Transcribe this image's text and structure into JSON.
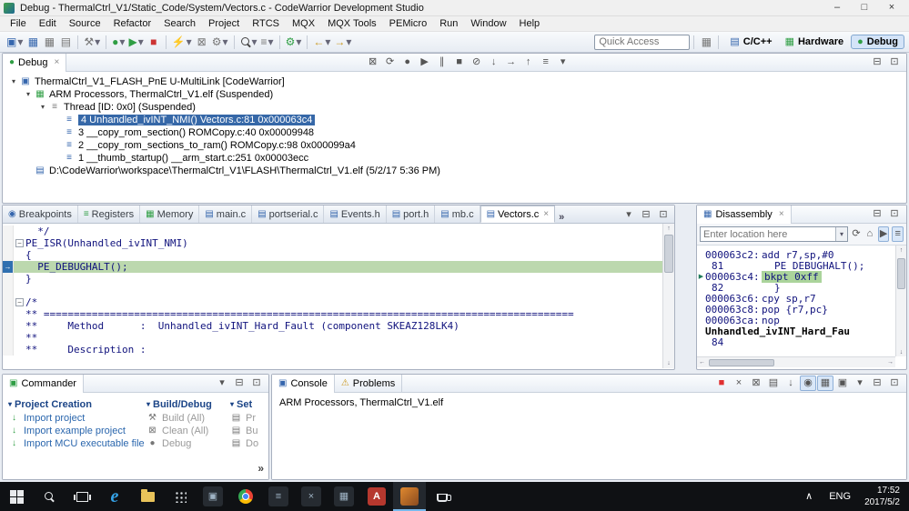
{
  "window": {
    "title": "Debug - ThermalCtrl_V1/Static_Code/System/Vectors.c - CodeWarrior Development Studio"
  },
  "menubar": {
    "items": [
      "File",
      "Edit",
      "Source",
      "Refactor",
      "Search",
      "Project",
      "RTCS",
      "MQX",
      "MQX Tools",
      "PEMicro",
      "Run",
      "Window",
      "Help"
    ]
  },
  "toolbar": {
    "quick_access_placeholder": "Quick Access",
    "perspectives": {
      "cpp": "C/C++",
      "hardware": "Hardware",
      "debug": "Debug"
    }
  },
  "debug_view": {
    "tab": "Debug",
    "tree": [
      {
        "label": "ThermalCtrl_V1_FLASH_PnE U-MultiLink [CodeWarrior]"
      },
      {
        "label": "ARM Processors, ThermalCtrl_V1.elf (Suspended)"
      },
      {
        "label": "Thread [ID: 0x0] (Suspended)"
      },
      {
        "label": "4 Unhandled_ivINT_NMI() Vectors.c:81 0x000063c4"
      },
      {
        "label": "3 __copy_rom_section() ROMCopy.c:40 0x00009948"
      },
      {
        "label": "2 __copy_rom_sections_to_ram() ROMCopy.c:98 0x000099a4"
      },
      {
        "label": "1 __thumb_startup() __arm_start.c:251 0x00003ecc"
      },
      {
        "label": "D:\\CodeWarrior\\workspace\\ThermalCtrl_V1\\FLASH\\ThermalCtrl_V1.elf (5/2/17 5:36 PM)"
      }
    ]
  },
  "editor": {
    "tabs": [
      {
        "label": "Breakpoints"
      },
      {
        "label": "Registers"
      },
      {
        "label": "Memory"
      },
      {
        "label": "main.c"
      },
      {
        "label": "portserial.c"
      },
      {
        "label": "Events.h"
      },
      {
        "label": "port.h"
      },
      {
        "label": "mb.c"
      },
      {
        "label": "Vectors.c"
      }
    ],
    "overflow": "»",
    "lines": [
      {
        "text": "  */"
      },
      {
        "text": "PE_ISR(Unhandled_ivINT_NMI)"
      },
      {
        "text": "{"
      },
      {
        "text": "  PE_DEBUGHALT();"
      },
      {
        "text": "}"
      },
      {
        "text": ""
      },
      {
        "text": "/*"
      },
      {
        "text": "** ========================================================================================"
      },
      {
        "text": "**     Method      :  Unhandled_ivINT_Hard_Fault (component SKEAZ128LK4)"
      },
      {
        "text": "**"
      },
      {
        "text": "**     Description :"
      }
    ]
  },
  "disassembly": {
    "title": "Disassembly",
    "location_placeholder": "Enter location here",
    "lines": [
      {
        "addr": "000063c2:",
        "instr": "add r7,sp,#0"
      },
      {
        "addr": "81",
        "instr": "PE_DEBUGHALT();"
      },
      {
        "addr": "000063c4:",
        "instr": "bkpt 0xff"
      },
      {
        "addr": "82",
        "instr": "}"
      },
      {
        "addr": "000063c6:",
        "instr": "cpy sp,r7"
      },
      {
        "addr": "000063c8:",
        "instr": "pop {r7,pc}"
      },
      {
        "addr": "000063ca:",
        "instr": "nop"
      },
      {
        "addr": "",
        "instr": "Unhandled_ivINT_Hard_Fau"
      },
      {
        "addr": "84",
        "instr": ""
      }
    ]
  },
  "commander": {
    "tab": "Commander",
    "sections": [
      {
        "title": "Project Creation",
        "items": [
          {
            "label": "Import project"
          },
          {
            "label": "Import example project"
          },
          {
            "label": "Import MCU executable file"
          }
        ]
      },
      {
        "title": "Build/Debug",
        "items": [
          {
            "label": "Build (All)"
          },
          {
            "label": "Clean (All)"
          },
          {
            "label": "Debug"
          }
        ]
      },
      {
        "title": "Set",
        "items": [
          {
            "label": "Pr"
          },
          {
            "label": "Bu"
          },
          {
            "label": "Do"
          }
        ]
      }
    ],
    "more": "»"
  },
  "console": {
    "tabs": [
      {
        "label": "Console"
      },
      {
        "label": "Problems"
      }
    ],
    "text": "ARM Processors, ThermalCtrl_V1.elf"
  },
  "taskbar": {
    "lang": "ENG",
    "time": "17:52",
    "date": "2017/5/2"
  }
}
